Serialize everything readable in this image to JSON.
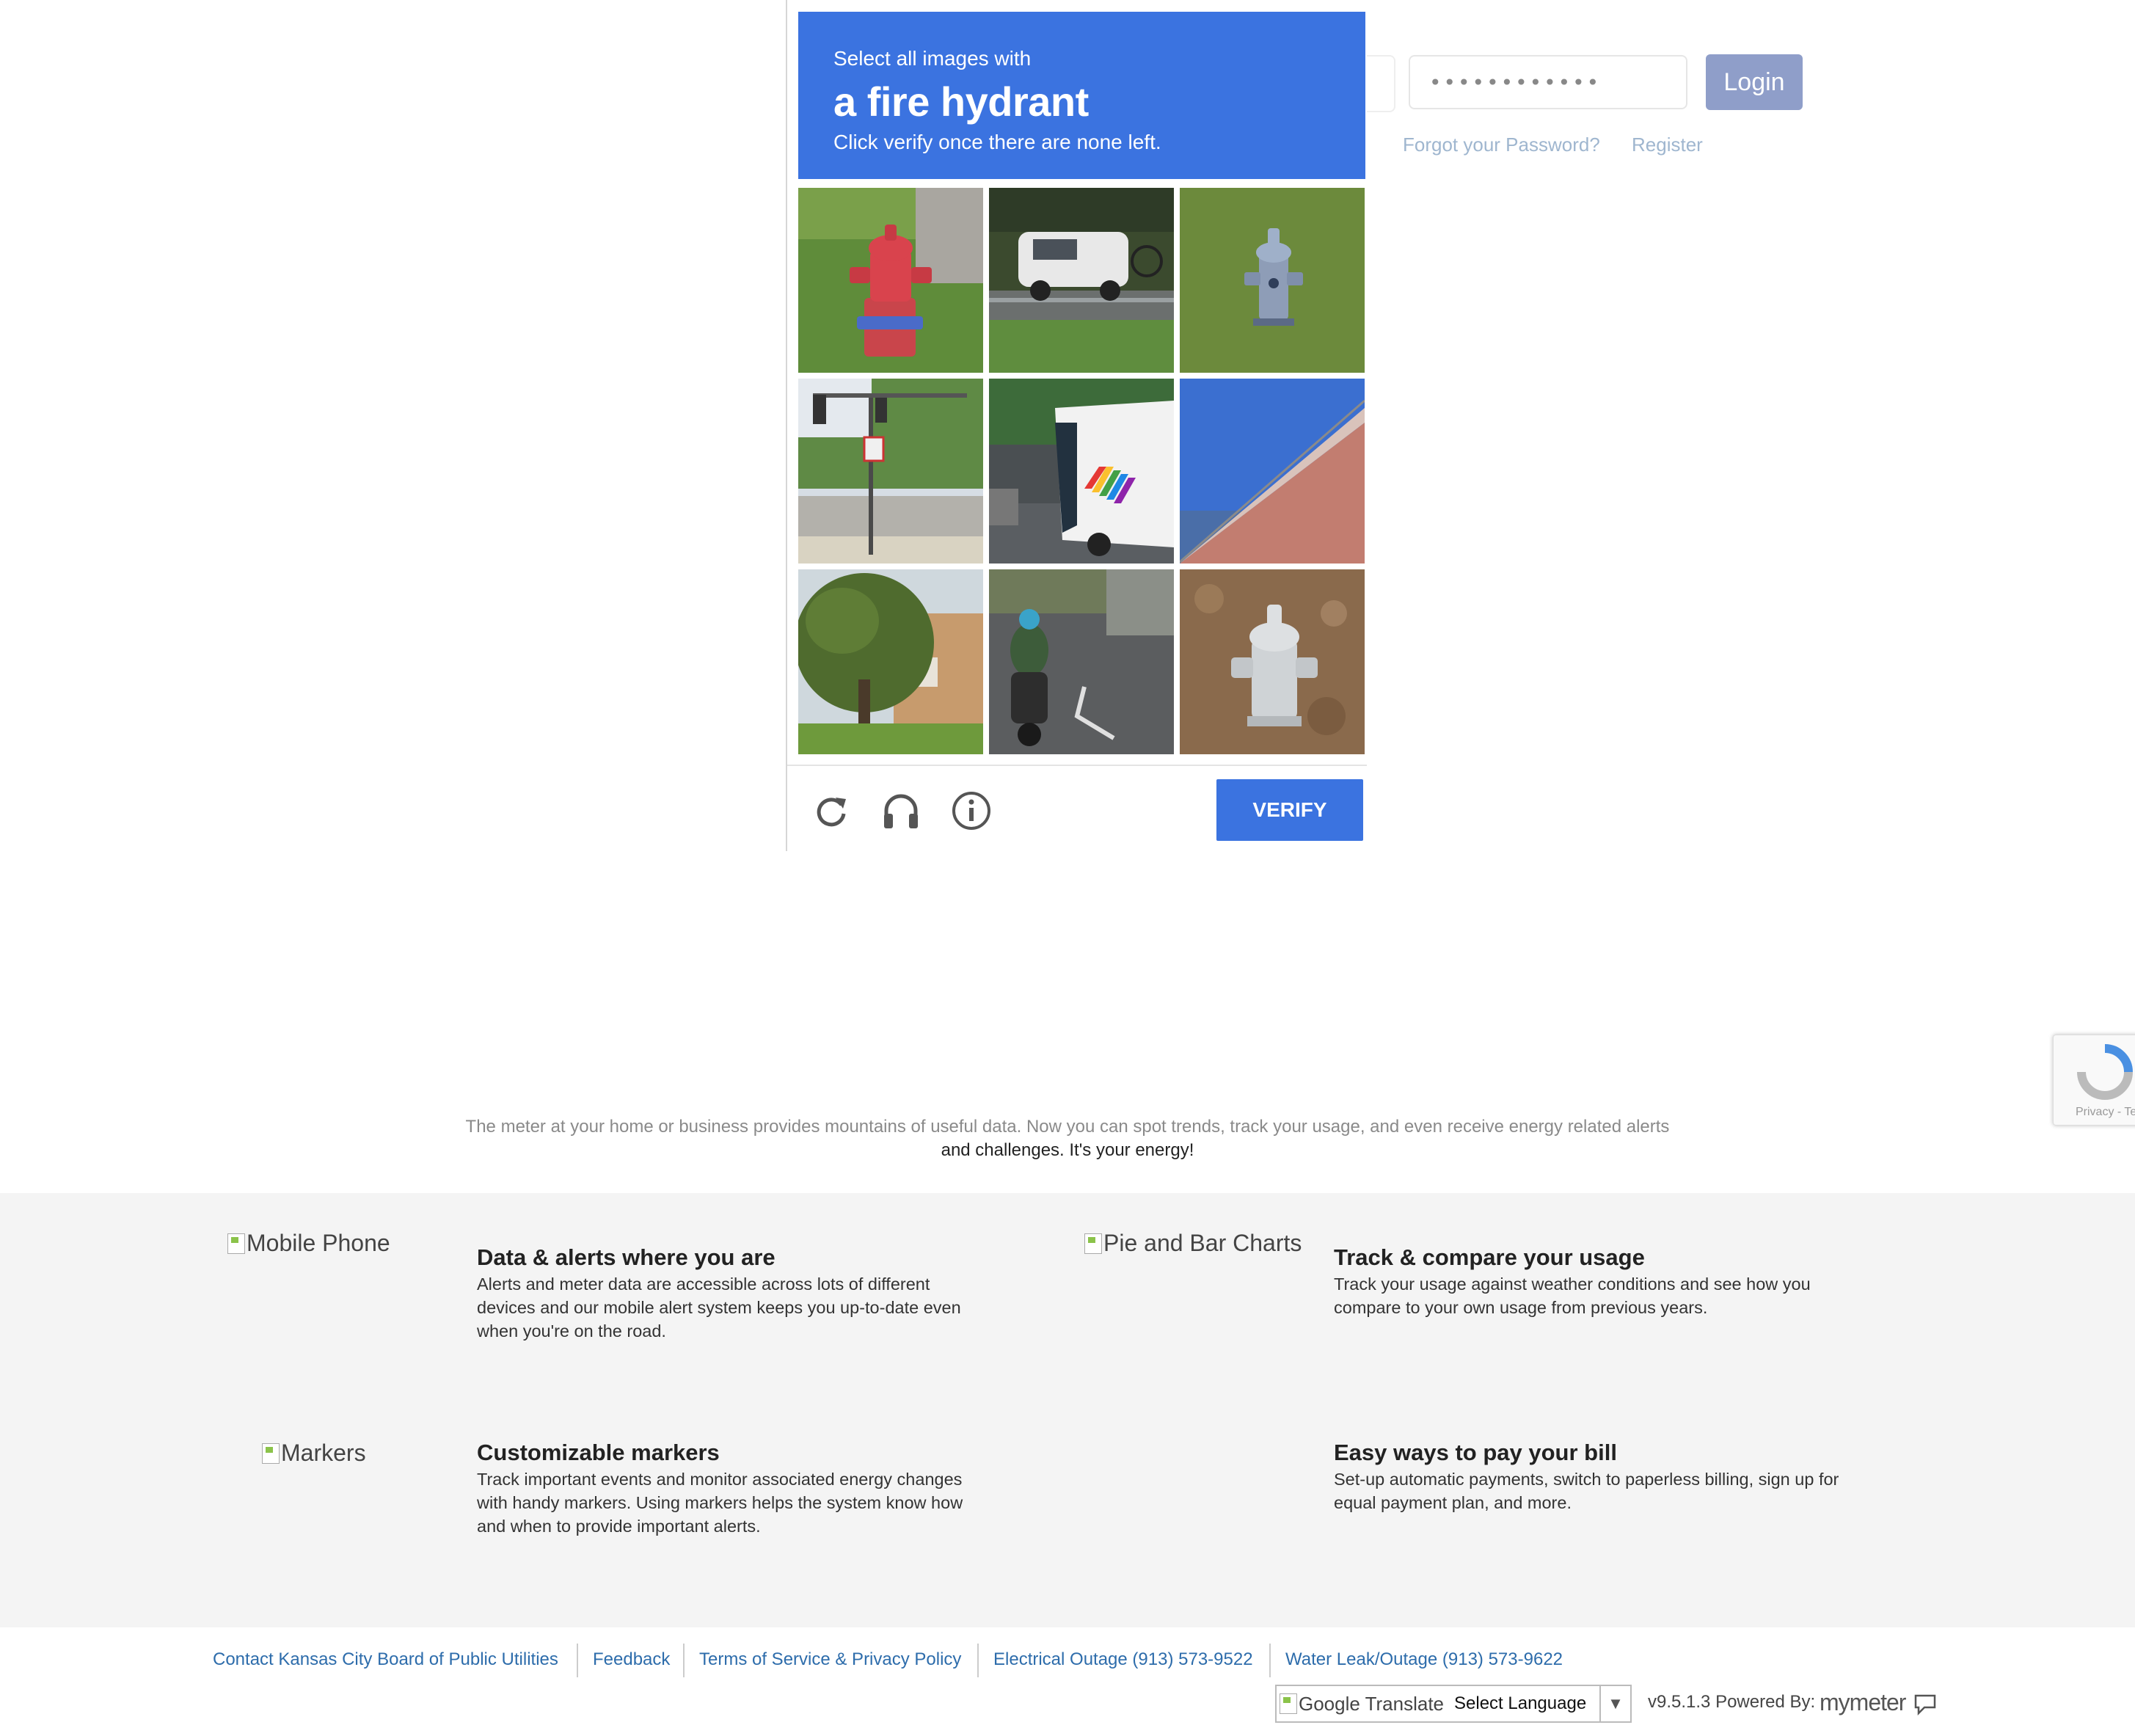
{
  "login": {
    "password_value": "••••••••••••",
    "login_label": "Login",
    "forgot_label": "Forgot your Password?",
    "register_label": "Register"
  },
  "captcha": {
    "instruction_top": "Select all images with",
    "target_object": "a fire hydrant",
    "instruction_bottom": "Click verify once there are none left.",
    "verify_label": "VERIFY",
    "accent_color": "#3b73e0",
    "controls": [
      "reload-icon",
      "headphones-icon",
      "info-icon"
    ]
  },
  "recaptcha_badge": {
    "text": "Privacy - Terms"
  },
  "intro": {
    "line1": "The meter at your home or business provides mountains of useful data. Now you can spot trends, track your usage, and even receive energy related alerts",
    "line2": "and challenges. It's your energy!"
  },
  "features": [
    {
      "img_alt": "Mobile Phone",
      "title": "Data & alerts where you are",
      "desc": "Alerts and meter data are accessible across lots of different devices and our mobile alert system keeps you up-to-date even when you're on the road."
    },
    {
      "img_alt": "Pie and Bar Charts",
      "title": "Track & compare your usage",
      "desc": "Track your usage against weather conditions and see how you compare to your own usage from previous years."
    },
    {
      "img_alt": "Markers",
      "title": "Customizable markers",
      "desc": "Track important events and monitor associated energy changes with handy markers. Using markers helps the system know how and when to provide important alerts."
    },
    {
      "img_alt": "",
      "title": "Easy ways to pay your bill",
      "desc": "Set-up automatic payments, switch to paperless billing, sign up for equal payment plan, and more."
    }
  ],
  "footer": {
    "links": [
      "Contact Kansas City Board of Public Utilities",
      "Feedback",
      "Terms of Service & Privacy Policy",
      "Electrical Outage (913) 573-9522",
      "Water Leak/Outage (913) 573-9622"
    ],
    "translate_img_alt": "Google Translate",
    "select_language": "Select Language",
    "select_arrow": "▼",
    "version": "v9.5.1.3 Powered By:",
    "brand": "mymeter"
  }
}
